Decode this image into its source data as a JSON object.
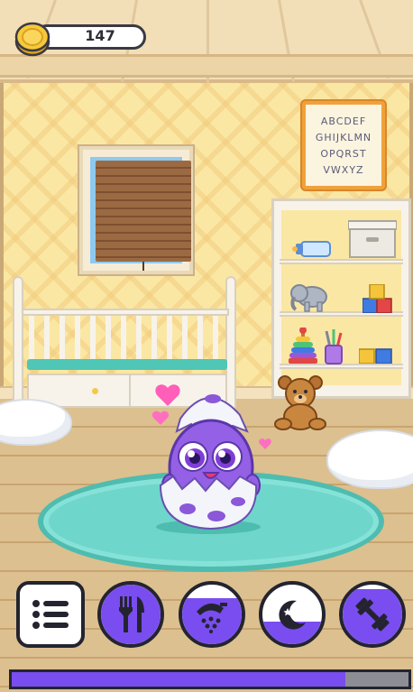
{
  "hud": {
    "coins": "147",
    "coin_icon": "gold-coin-icon"
  },
  "poster": {
    "lines": [
      "ABCDEF",
      "GHIJKLMN",
      "OPQRST",
      "VWXYZ"
    ]
  },
  "buttons": [
    {
      "id": "menu",
      "icon": "list-icon",
      "fill": null
    },
    {
      "id": "food",
      "icon": "fork-knife-icon",
      "fill": 1.0
    },
    {
      "id": "clean",
      "icon": "shower-icon",
      "fill": 0.78
    },
    {
      "id": "sleep",
      "icon": "moon-icon",
      "fill": 0.38
    },
    {
      "id": "fitness",
      "icon": "dumbbell-icon",
      "fill": 0.92
    }
  ],
  "level_progress": 0.84,
  "colors": {
    "accent": "#7a4df0",
    "outline": "#242430",
    "rug": "#6fd6cb",
    "wall": "#fbe7a4"
  }
}
